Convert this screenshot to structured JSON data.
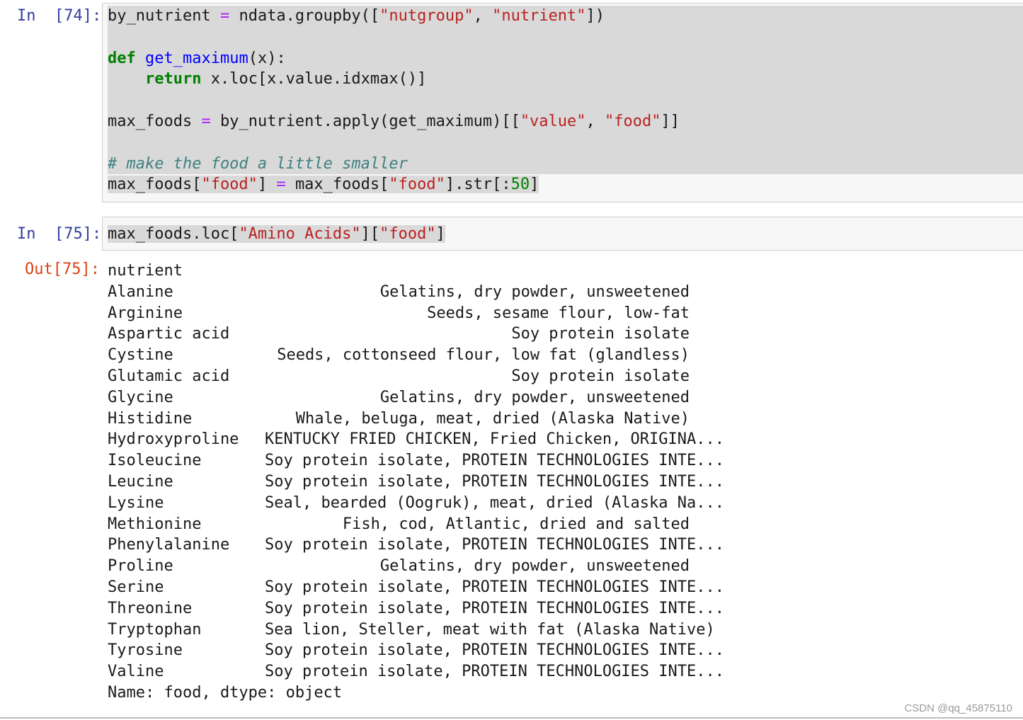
{
  "cell74": {
    "prompt": "In  [74]:",
    "code": {
      "l1_a": "by_nutrient",
      "l1_eq": " = ",
      "l1_b": "ndata.groupby([",
      "l1_s1": "\"nutgroup\"",
      "l1_c": ", ",
      "l1_s2": "\"nutrient\"",
      "l1_d": "])",
      "l3_def": "def",
      "l3_fn": "get_maximum",
      "l3_rest": "(x):",
      "l4_indent": "    ",
      "l4_ret": "return",
      "l4_rest": " x.loc[x.value.idxmax()]",
      "l6_a": "max_foods",
      "l6_eq": " = ",
      "l6_b": "by_nutrient.apply(get_maximum)[[",
      "l6_s1": "\"value\"",
      "l6_c": ", ",
      "l6_s2": "\"food\"",
      "l6_d": "]]",
      "l8_comment": "# make the food a little smaller",
      "l9_a": "max_foods[",
      "l9_s1": "\"food\"",
      "l9_b": "]",
      "l9_eq": " = ",
      "l9_c": "max_foods[",
      "l9_s2": "\"food\"",
      "l9_d": "].str[:",
      "l9_num": "50",
      "l9_e": "]"
    }
  },
  "cell75": {
    "prompt": "In  [75]:",
    "code": {
      "a": "max_foods.loc[",
      "s1": "\"Amino Acids\"",
      "b": "][",
      "s2": "\"food\"",
      "c": "]"
    },
    "out_prompt": "Out[75]:",
    "output": {
      "header": "nutrient",
      "rows": [
        {
          "nutrient": "Alanine",
          "food": "Gelatins, dry powder, unsweetened"
        },
        {
          "nutrient": "Arginine",
          "food": "Seeds, sesame flour, low-fat"
        },
        {
          "nutrient": "Aspartic acid",
          "food": "Soy protein isolate"
        },
        {
          "nutrient": "Cystine",
          "food": "Seeds, cottonseed flour, low fat (glandless)"
        },
        {
          "nutrient": "Glutamic acid",
          "food": "Soy protein isolate"
        },
        {
          "nutrient": "Glycine",
          "food": "Gelatins, dry powder, unsweetened"
        },
        {
          "nutrient": "Histidine",
          "food": "Whale, beluga, meat, dried (Alaska Native)"
        },
        {
          "nutrient": "Hydroxyproline",
          "food": "KENTUCKY FRIED CHICKEN, Fried Chicken, ORIGINA..."
        },
        {
          "nutrient": "Isoleucine",
          "food": "Soy protein isolate, PROTEIN TECHNOLOGIES INTE..."
        },
        {
          "nutrient": "Leucine",
          "food": "Soy protein isolate, PROTEIN TECHNOLOGIES INTE..."
        },
        {
          "nutrient": "Lysine",
          "food": "Seal, bearded (Oogruk), meat, dried (Alaska Na..."
        },
        {
          "nutrient": "Methionine",
          "food": "Fish, cod, Atlantic, dried and salted"
        },
        {
          "nutrient": "Phenylalanine",
          "food": "Soy protein isolate, PROTEIN TECHNOLOGIES INTE..."
        },
        {
          "nutrient": "Proline",
          "food": "Gelatins, dry powder, unsweetened"
        },
        {
          "nutrient": "Serine",
          "food": "Soy protein isolate, PROTEIN TECHNOLOGIES INTE..."
        },
        {
          "nutrient": "Threonine",
          "food": "Soy protein isolate, PROTEIN TECHNOLOGIES INTE..."
        },
        {
          "nutrient": "Tryptophan",
          "food": "Sea lion, Steller, meat with fat (Alaska Native)"
        },
        {
          "nutrient": "Tyrosine",
          "food": "Soy protein isolate, PROTEIN TECHNOLOGIES INTE..."
        },
        {
          "nutrient": "Valine",
          "food": "Soy protein isolate, PROTEIN TECHNOLOGIES INTE..."
        }
      ],
      "footer": "Name: food, dtype: object"
    }
  },
  "watermark": "CSDN @qq_45875110"
}
